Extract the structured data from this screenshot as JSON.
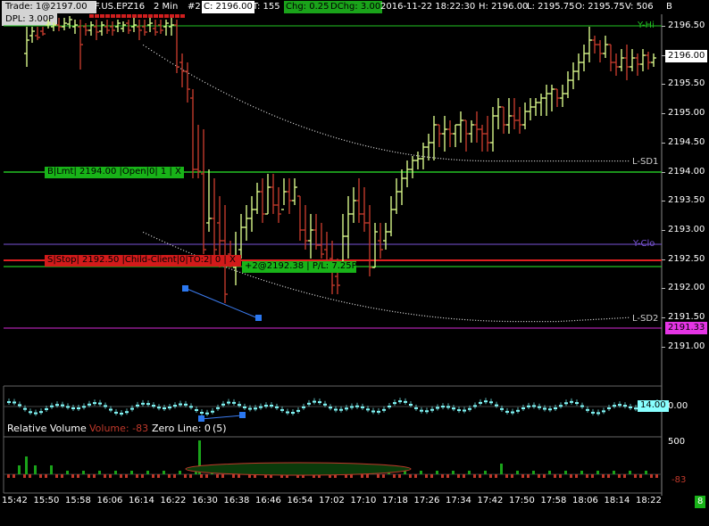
{
  "header": {
    "trade": "Trade: 1@2197.00",
    "dpl": "DPL: 3.00P",
    "symbol": "F.US.EPZ16",
    "interval": "2 Min",
    "number": "#2",
    "close": "C: 2196.00",
    "ticks": "T: 155",
    "change": "Chg: 0.25",
    "dchange": "DChg: 3.00",
    "datetime": "2016-11-22 18:22:30",
    "high": "H: 2196.00",
    "low": "L: 2195.75",
    "open": "O: 2195.75",
    "volume": "V: 506",
    "volume_suffix": "B"
  },
  "colors": {
    "up_bar": "#d7f58a",
    "down_bar": "#c0392b",
    "green_line": "#22c322",
    "red_order": "#e02020",
    "purple_line": "#7a55d8",
    "magenta_line": "#d62ad6"
  },
  "lines": {
    "y_hi": "Y-Hi",
    "l_sd1": "L-SD1",
    "y_clo": "Y-Clo",
    "l_sd2": "L-SD2"
  },
  "orders": {
    "buy_limit": "B|Lmt| 2194.00 |Open|0| 1 | X",
    "sell_stop": "S|Stop| 2192.50 |Child-Client|0|TO:2| 0 | X",
    "position": "+2@2192.38 | P/L: 7.25P"
  },
  "price_axis": {
    "labels": [
      "2196.50",
      "2196.00",
      "2195.50",
      "2195.00",
      "2194.50",
      "2194.00",
      "2193.50",
      "2193.00",
      "2192.50",
      "2192.00",
      "2191.50",
      "2191.00"
    ],
    "current_price": "2196.00",
    "magenta_price": "2191.33"
  },
  "delta_panel": {
    "current_value": "14.00",
    "axis_label": "0.00"
  },
  "volume_panel": {
    "title": "Relative Volume",
    "volume_label": "Volume: -83",
    "zero_line": "Zero Line: 0",
    "param": "(5)",
    "axis_500": "500",
    "axis_val": "-83"
  },
  "time_axis": {
    "labels": [
      "15:42",
      "15:50",
      "15:58",
      "16:06",
      "16:14",
      "16:22",
      "16:30",
      "16:38",
      "16:46",
      "16:54",
      "17:02",
      "17:10",
      "17:18",
      "17:26",
      "17:34",
      "17:42",
      "17:50",
      "17:58",
      "18:06",
      "18:14",
      "18:22"
    ],
    "corner_badge": "8"
  },
  "chart_data": {
    "type": "bar",
    "title": "F.US.EPZ16 2 Min",
    "ylim": [
      2190.75,
      2196.75
    ],
    "x_range": [
      "15:42",
      "18:22"
    ],
    "y_unit": "price",
    "reference_lines": {
      "Y-Hi": 2196.5,
      "L-SD1": 2194.15,
      "Y-Clo": 2192.8,
      "L-SD2": 2191.5,
      "magenta": 2191.33
    },
    "orders": {
      "buy_limit": 2194.0,
      "sell_stop": 2192.5,
      "position": 2192.38
    }
  }
}
